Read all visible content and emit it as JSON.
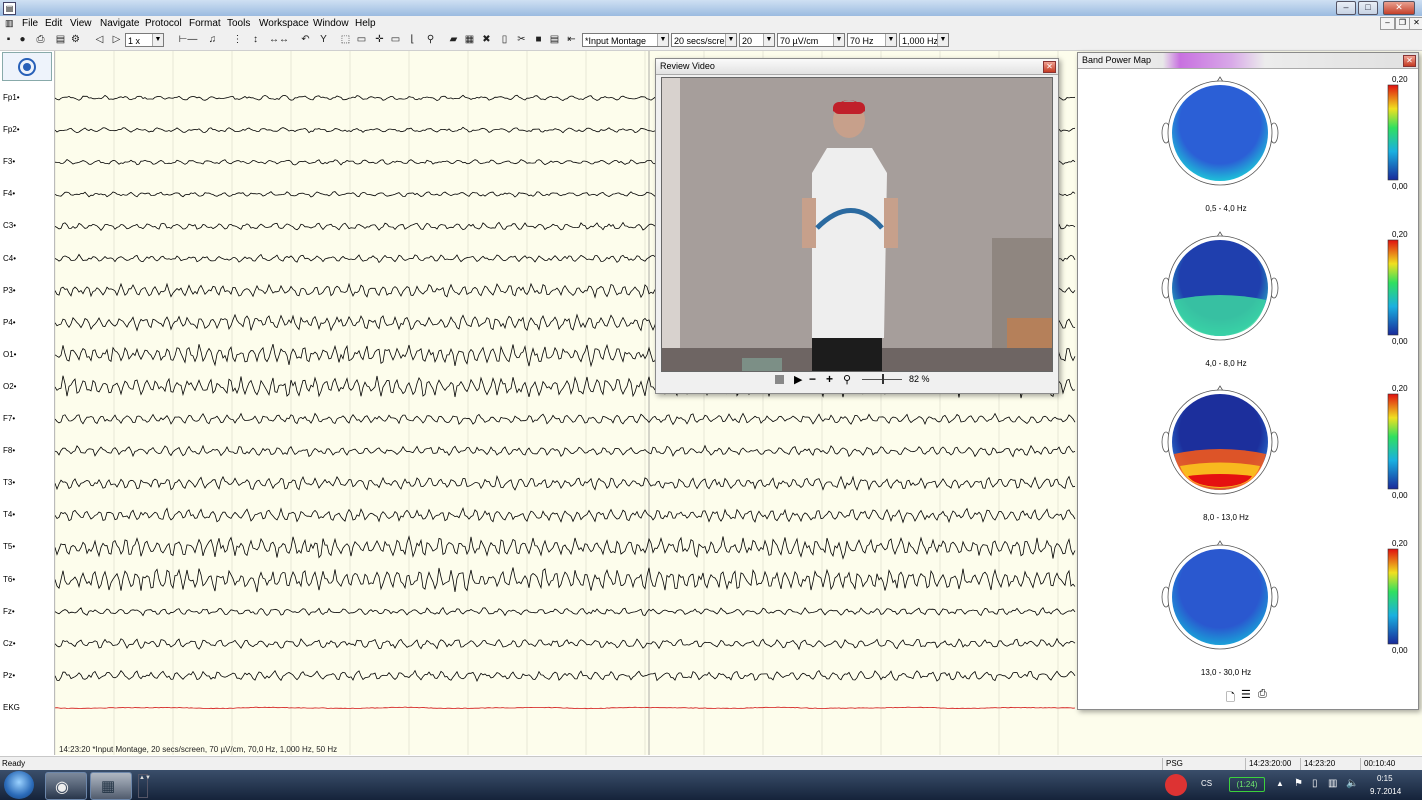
{
  "app": {
    "menu": [
      "File",
      "Edit",
      "View",
      "Navigate",
      "Protocol",
      "Format",
      "Tools",
      "Workspace",
      "Window",
      "Help"
    ]
  },
  "toolbar": {
    "speed": "1 x",
    "montage": "*Input Montage",
    "secs_per_screen": "20 secs/scree",
    "gain_count": "20",
    "sensitivity": "70 µV/cm",
    "lowpass": "70 Hz",
    "highpass": "1,000 Hz"
  },
  "channels": [
    "Fp1",
    "Fp2",
    "F3",
    "F4",
    "C3",
    "C4",
    "P3",
    "P4",
    "O1",
    "O2",
    "F7",
    "F8",
    "T3",
    "T4",
    "T5",
    "T6",
    "Fz",
    "Cz",
    "Pz",
    "EKG"
  ],
  "eeg_info": "14:23:20 *Input Montage, 20 secs/screen, 70 µV/cm, 70,0 Hz, 1,000 Hz, 50 Hz",
  "colors": {
    "trace": "#000000",
    "ekg_trace": "#d21414",
    "grid": "#d8d8c8",
    "eeg_bg": "#fdfdec"
  },
  "video": {
    "title": "Review Video",
    "zoom": "82 %",
    "icons": [
      "stop-icon",
      "play-icon",
      "zoom-out-icon",
      "zoom-in-icon",
      "magnifier-icon"
    ]
  },
  "band_map": {
    "title": "Band Power Map",
    "scale_max": "0,20",
    "scale_min": "0,00",
    "bands": [
      "0,5 - 4,0 Hz",
      "4,0 - 8,0 Hz",
      "8,0 - 13,0 Hz",
      "13,0 - 30,0 Hz"
    ],
    "icons": [
      "page-icon",
      "list-icon",
      "printer-icon"
    ]
  },
  "status": {
    "ready": "Ready",
    "mode": "PSG",
    "time_start": "14:23:20:00",
    "time_cursor": "14:23:20",
    "duration": "00:10:40"
  },
  "taskbar": {
    "lang": "CS",
    "battery": "(1:24)",
    "time": "0:15",
    "date": "9.7.2014"
  }
}
